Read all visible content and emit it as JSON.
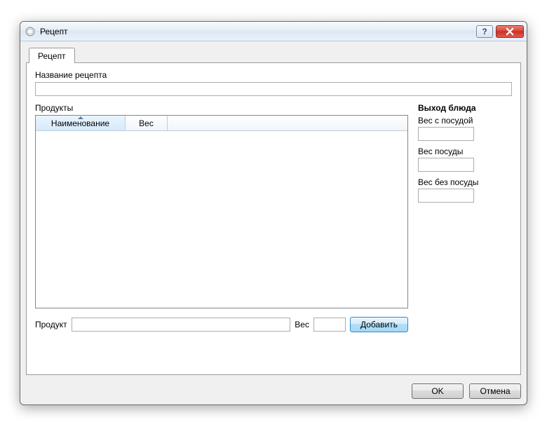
{
  "window": {
    "title": "Рецепт"
  },
  "tab": {
    "label": "Рецепт"
  },
  "recipe_name": {
    "label": "Название рецепта",
    "value": ""
  },
  "products": {
    "label": "Продукты",
    "columns": {
      "name": "Наименование",
      "weight": "Вес"
    },
    "rows": []
  },
  "output": {
    "heading": "Выход блюда",
    "with_dish": {
      "label": "Вес с посудой",
      "value": ""
    },
    "dish": {
      "label": "Вес посуды",
      "value": ""
    },
    "without_dish": {
      "label": "Вес без посуды",
      "value": ""
    }
  },
  "add": {
    "product_label": "Продукт",
    "product_value": "",
    "weight_label": "Вес",
    "weight_value": "",
    "button": "Добавить"
  },
  "buttons": {
    "ok": "OK",
    "cancel": "Отмена"
  }
}
